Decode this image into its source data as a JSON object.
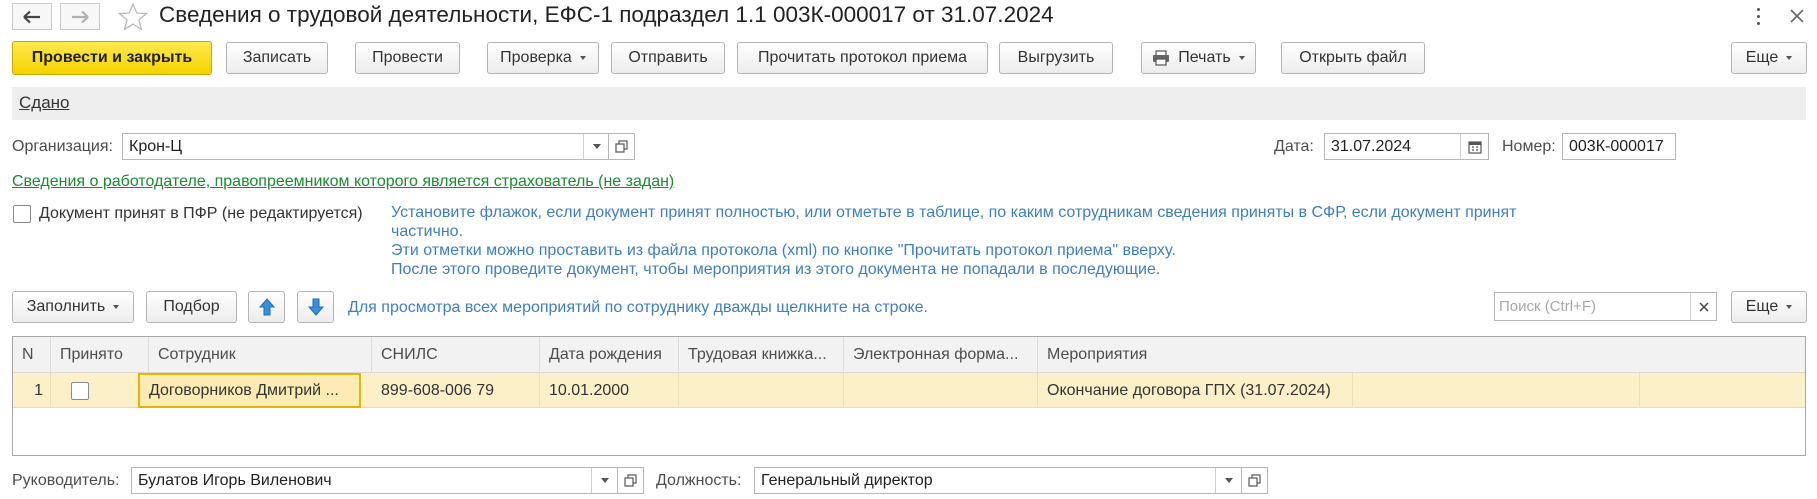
{
  "window": {
    "title": "Сведения о трудовой деятельности, ЕФС-1 подраздел 1.1 003К-000017 от 31.07.2024"
  },
  "icons": {
    "back": "arrow-left-icon",
    "forward": "arrow-right-icon",
    "favorite": "star-icon",
    "more": "kebab-menu-icon",
    "close": "close-icon",
    "print": "printer-icon",
    "calendar": "calendar-icon",
    "open": "open-in-window-icon",
    "up": "arrow-up-icon",
    "down": "arrow-down-icon",
    "clear": "clear-icon"
  },
  "colors": {
    "primary_button": "#f5d300",
    "hint_text": "#3f7fbf",
    "link_green": "#1a8c2e",
    "selected_row": "#fbf0c8",
    "active_cell_border": "#e8b400"
  },
  "toolbar": {
    "post_close": "Провести и закрыть",
    "save": "Записать",
    "post": "Провести",
    "check": "Проверка",
    "send": "Отправить",
    "read_protocol": "Прочитать протокол приема",
    "export": "Выгрузить",
    "print": "Печать",
    "open_file": "Открыть файл",
    "more": "Еще"
  },
  "status": {
    "link": "Сдано"
  },
  "form": {
    "org_label": "Организация:",
    "org_value": "Крон-Ц",
    "date_label": "Дата:",
    "date_value": "31.07.2024",
    "number_label": "Номер:",
    "number_value": "003К-000017",
    "employer_link": "Сведения о работодателе, правопреемником которого является страхователь (не задан)",
    "accepted_label": "Документ принят в ПФР (не редактируется)",
    "accepted_checked": false
  },
  "hint": {
    "line1": "Установите флажок, если документ принят полностью, или отметьте в таблице, по каким сотрудникам сведения приняты в СФР, если документ принят",
    "line2": "частично.",
    "line3": "Эти отметки можно проставить из файла протокола (xml) по кнопке \"Прочитать протокол приема\" вверху.",
    "line4": "После этого проведите документ, чтобы мероприятия из этого документа не попадали в последующие."
  },
  "table_toolbar": {
    "fill": "Заполнить",
    "pick": "Подбор",
    "hint": "Для просмотра всех мероприятий по сотруднику дважды щелкните на строке.",
    "search_placeholder": "Поиск (Ctrl+F)",
    "more": "Еще"
  },
  "table": {
    "columns": [
      "N",
      "Принято",
      "Сотрудник",
      "СНИЛС",
      "Дата рождения",
      "Трудовая книжка...",
      "Электронная форма...",
      "Мероприятия"
    ],
    "rows": [
      {
        "n": "1",
        "accepted": false,
        "employee": "Договорников Дмитрий ...",
        "snils": "899-608-006 79",
        "birth_date": "10.01.2000",
        "labor_book": "",
        "electronic_form": "",
        "events": "Окончание договора ГПХ (31.07.2024)"
      }
    ]
  },
  "footer": {
    "head_label": "Руководитель:",
    "head_value": "Булатов Игорь Виленович",
    "position_label": "Должность:",
    "position_value": "Генеральный директор"
  }
}
